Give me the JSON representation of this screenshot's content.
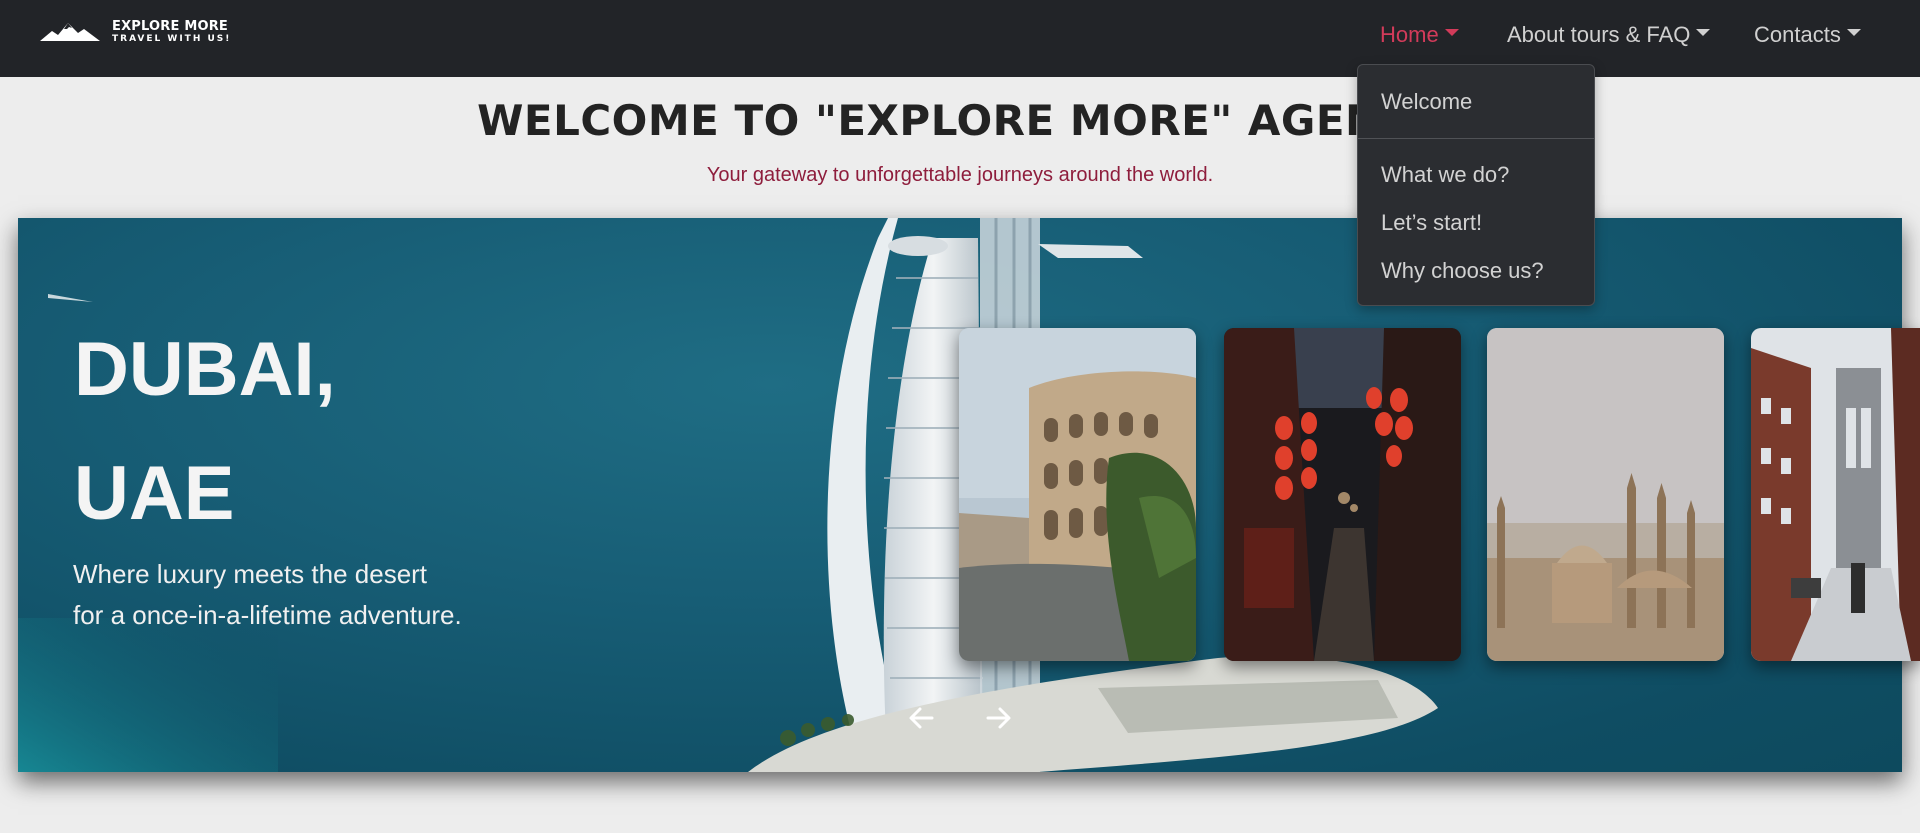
{
  "brand": {
    "title": "EXPLORE MORE",
    "subtitle": "TRAVEL WITH US!"
  },
  "nav": {
    "home": "Home",
    "about": "About tours & FAQ",
    "contacts": "Contacts",
    "active": "Home",
    "active_color": "#d23b5a"
  },
  "dropdown": {
    "items": [
      "Welcome",
      "What we do?",
      "Let’s start!",
      "Why choose us?"
    ]
  },
  "header": {
    "title": "WELCOME TO \"EXPLORE MORE\" AGENCY",
    "subtitle": "Your gateway to unforgettable journeys around the world."
  },
  "hero": {
    "title": "DUBAI,\nUAE",
    "description": "Where luxury meets the desert for a once-in-a-lifetime adventure.",
    "prev_icon": "arrow-left-icon",
    "next_icon": "arrow-right-icon"
  },
  "cards": [
    {
      "name": "colosseum-card",
      "depicts": "colosseum"
    },
    {
      "name": "lantern-street-card",
      "depicts": "lantern-street"
    },
    {
      "name": "mosque-skyline-card",
      "depicts": "mosque-skyline"
    },
    {
      "name": "bridge-snow-card",
      "depicts": "bridge-snow"
    }
  ],
  "colors": {
    "navbar": "#222428",
    "page_bg": "#ededed",
    "subtitle": "#8e1d3c",
    "hero_sea": "#175d75"
  }
}
